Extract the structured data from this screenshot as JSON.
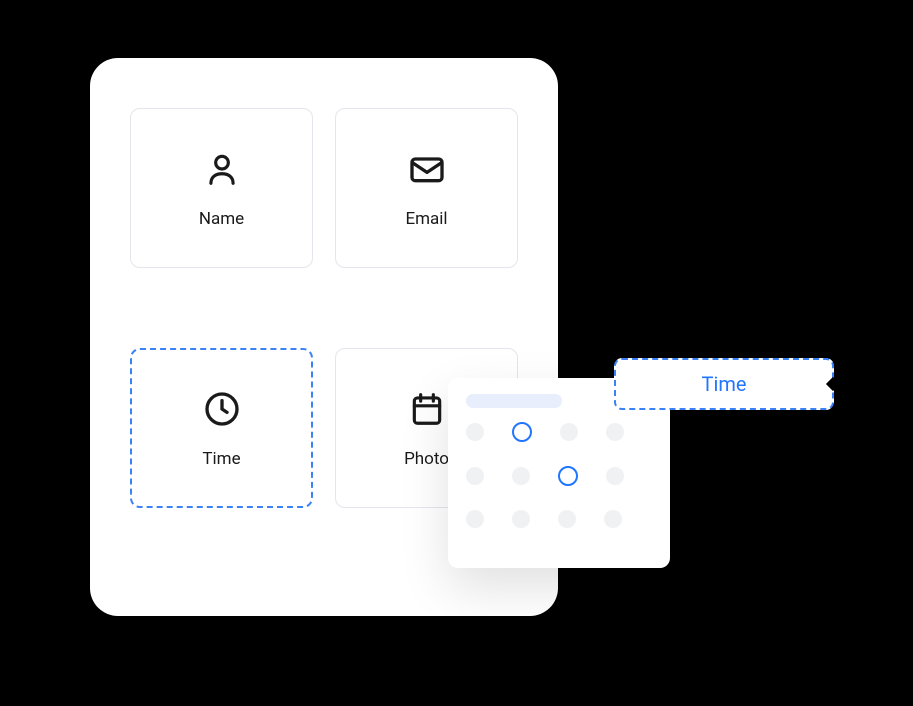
{
  "panel": {
    "cards": [
      {
        "label": "Name",
        "icon": "person",
        "selected": false
      },
      {
        "label": "Email",
        "icon": "envelope",
        "selected": false
      },
      {
        "label": "Time",
        "icon": "clock",
        "selected": true
      },
      {
        "label": "Photo",
        "icon": "calendar",
        "selected": false
      }
    ]
  },
  "dotGrid": {
    "rows": 3,
    "cols": 4,
    "active": [
      {
        "row": 0,
        "col": 1
      },
      {
        "row": 1,
        "col": 2
      }
    ]
  },
  "tag": {
    "label": "Time"
  },
  "colors": {
    "accent": "#2176ff",
    "border": "#e4e6eb",
    "dashedBorder": "#3b82f6"
  }
}
